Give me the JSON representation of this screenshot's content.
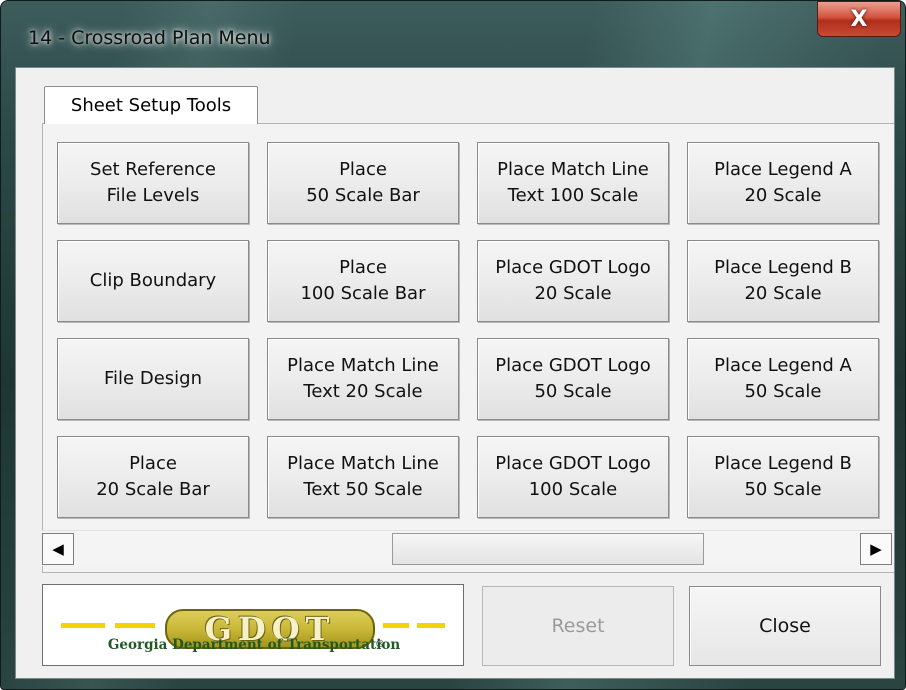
{
  "window": {
    "title": "14 - Crossroad Plan Menu",
    "close_glyph": "X"
  },
  "tabs": [
    {
      "label": "Sheet Setup Tools",
      "selected": true
    }
  ],
  "buttons": [
    "Set Reference\nFile Levels",
    "Place\n50 Scale Bar",
    "Place Match Line\nText 100 Scale",
    "Place Legend A\n20 Scale",
    "Clip Boundary",
    "Place\n100 Scale Bar",
    "Place GDOT Logo\n20 Scale",
    "Place Legend B\n20 Scale",
    "File Design",
    "Place Match Line\nText 20 Scale",
    "Place GDOT Logo\n50 Scale",
    "Place Legend A\n50 Scale",
    "Place\n20 Scale Bar",
    "Place Match Line\nText 50 Scale",
    "Place GDOT Logo\n100 Scale",
    "Place Legend B\n50 Scale"
  ],
  "scrollbar": {
    "left_arrow": "◀",
    "right_arrow": "▶"
  },
  "logo": {
    "wordmark": "GDOT",
    "registered": "®",
    "agency": "Georgia Department of Transportation"
  },
  "footer": {
    "reset_label": "Reset",
    "reset_enabled": false,
    "close_label": "Close"
  },
  "colors": {
    "logo_yellow": "#f6d200",
    "logo_green": "#1f5a25",
    "close_red": "#c84a33"
  }
}
